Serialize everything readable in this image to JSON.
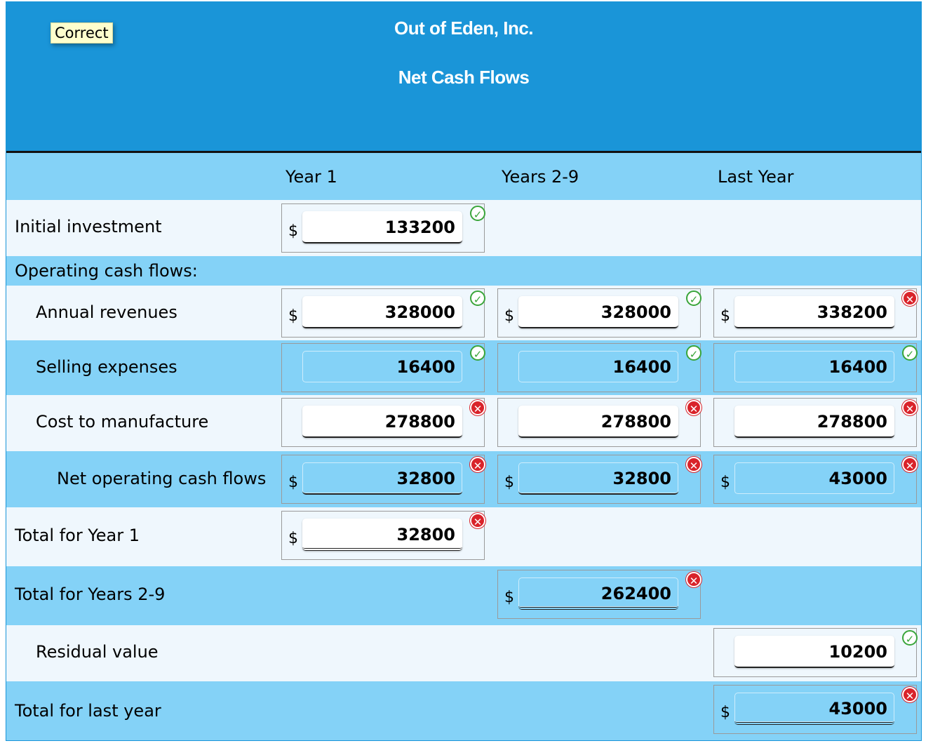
{
  "header": {
    "company": "Out of Eden, Inc.",
    "title": "Net Cash Flows",
    "feedback_tag": "Correct"
  },
  "columns": [
    "Year 1",
    "Years 2-9",
    "Last Year"
  ],
  "currency_symbol": "$",
  "rows": {
    "initial_investment": {
      "label": "Initial investment",
      "year1": "133200"
    },
    "operating_header": {
      "label": "Operating cash flows:"
    },
    "annual_revenues": {
      "label": "Annual revenues",
      "year1": "328000",
      "years2_9": "328000",
      "last_year": "338200"
    },
    "selling_expenses": {
      "label": "Selling expenses",
      "year1": "16400",
      "years2_9": "16400",
      "last_year": "16400"
    },
    "cost_to_manufacture": {
      "label": "Cost to manufacture",
      "year1": "278800",
      "years2_9": "278800",
      "last_year": "278800"
    },
    "net_operating": {
      "label": "Net operating cash flows",
      "year1": "32800",
      "years2_9": "32800",
      "last_year": "43000"
    },
    "total_year1": {
      "label": "Total for Year 1",
      "year1": "32800"
    },
    "total_years2_9": {
      "label": "Total for Years 2-9",
      "years2_9": "262400"
    },
    "residual_value": {
      "label": "Residual value",
      "last_year": "10200"
    },
    "total_last_year": {
      "label": "Total for last year",
      "last_year": "43000"
    }
  },
  "status_colors": {
    "correct": "#3aa53a",
    "incorrect": "#d9232a"
  },
  "status_icons": {
    "correct": "check-circle-icon",
    "incorrect": "x-circle-icon"
  }
}
